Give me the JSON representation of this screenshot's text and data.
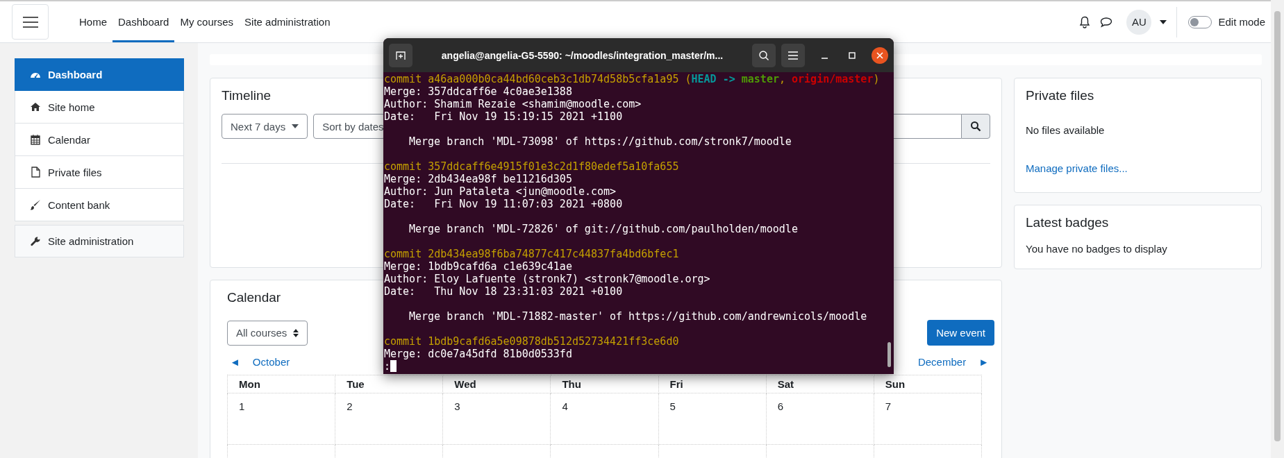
{
  "navbar": {
    "links": [
      {
        "label": "Home",
        "selected": false
      },
      {
        "label": "Dashboard",
        "selected": true
      },
      {
        "label": "My courses",
        "selected": false
      },
      {
        "label": "Site administration",
        "selected": false
      }
    ],
    "avatar": "AU",
    "edit_mode": {
      "label": "Edit mode",
      "on": false
    }
  },
  "sidebar": {
    "items": [
      {
        "label": "Dashboard",
        "selected": true
      },
      {
        "label": "Site home",
        "selected": false
      },
      {
        "label": "Calendar",
        "selected": false
      },
      {
        "label": "Private files",
        "selected": false
      },
      {
        "label": "Content bank",
        "selected": false
      }
    ],
    "admin": {
      "label": "Site administration",
      "selected": false
    }
  },
  "timeline": {
    "title": "Timeline",
    "filter": "Next 7 days",
    "sort": "Sort by dates"
  },
  "calendar": {
    "title": "Calendar",
    "course_filter": "All courses",
    "new_event": "New event",
    "prev": {
      "arrow": "◄",
      "label": "October"
    },
    "next": {
      "arrow": "►",
      "label": "December"
    },
    "days": [
      "Mon",
      "Tue",
      "Wed",
      "Thu",
      "Fri",
      "Sat",
      "Sun"
    ],
    "weeks": [
      [
        "1",
        "2",
        "3",
        "4",
        "5",
        "6",
        "7"
      ]
    ]
  },
  "private_files": {
    "title": "Private files",
    "message": "No files available",
    "link": "Manage private files..."
  },
  "latest_badges": {
    "title": "Latest badges",
    "message": "You have no badges to display"
  },
  "terminal": {
    "title": "angelia@angelia-G5-5590: ~/moodles/integration_master/m...",
    "lines": [
      {
        "kind": "commit",
        "segments": [
          {
            "kind": "plain",
            "text": "commit a46aa000b0ca44bd60ceb3c1db74d58b5cfa1a95 ("
          },
          {
            "kind": "head",
            "text": "HEAD -> "
          },
          {
            "kind": "branch",
            "text": "master"
          },
          {
            "kind": "plain",
            "text": ", "
          },
          {
            "kind": "remote",
            "text": "origin/master"
          },
          {
            "kind": "plain",
            "text": ")"
          }
        ]
      },
      {
        "kind": "text",
        "segments": [
          {
            "kind": "plain",
            "text": "Merge: 357ddcaff6e 4c0ae3e1388"
          }
        ]
      },
      {
        "kind": "text",
        "segments": [
          {
            "kind": "plain",
            "text": "Author: Shamim Rezaie <shamim@moodle.com>"
          }
        ]
      },
      {
        "kind": "text",
        "segments": [
          {
            "kind": "plain",
            "text": "Date:   Fri Nov 19 15:19:15 2021 +1100"
          }
        ]
      },
      {
        "kind": "message",
        "segments": [
          {
            "kind": "plain",
            "text": "Merge branch 'MDL-73098' of https://github.com/stronk7/moodle"
          }
        ]
      },
      {
        "kind": "commit",
        "segments": [
          {
            "kind": "plain",
            "text": "commit 357ddcaff6e4915f01e3c2d1f80edef5a10fa655"
          }
        ]
      },
      {
        "kind": "text",
        "segments": [
          {
            "kind": "plain",
            "text": "Merge: 2db434ea98f be11216d305"
          }
        ]
      },
      {
        "kind": "text",
        "segments": [
          {
            "kind": "plain",
            "text": "Author: Jun Pataleta <jun@moodle.com>"
          }
        ]
      },
      {
        "kind": "text",
        "segments": [
          {
            "kind": "plain",
            "text": "Date:   Fri Nov 19 11:07:03 2021 +0800"
          }
        ]
      },
      {
        "kind": "message",
        "segments": [
          {
            "kind": "plain",
            "text": "Merge branch 'MDL-72826' of git://github.com/paulholden/moodle"
          }
        ]
      },
      {
        "kind": "commit",
        "segments": [
          {
            "kind": "plain",
            "text": "commit 2db434ea98f6ba74877c417c44837fa4bd6bfec1"
          }
        ]
      },
      {
        "kind": "text",
        "segments": [
          {
            "kind": "plain",
            "text": "Merge: 1bdb9cafd6a c1e639c41ae"
          }
        ]
      },
      {
        "kind": "text",
        "segments": [
          {
            "kind": "plain",
            "text": "Author: Eloy Lafuente (stronk7) <stronk7@moodle.org>"
          }
        ]
      },
      {
        "kind": "text",
        "segments": [
          {
            "kind": "plain",
            "text": "Date:   Thu Nov 18 23:31:03 2021 +0100"
          }
        ]
      },
      {
        "kind": "message",
        "segments": [
          {
            "kind": "plain",
            "text": "Merge branch 'MDL-71882-master' of https://github.com/andrewnicols/moodle"
          }
        ]
      },
      {
        "kind": "commit",
        "segments": [
          {
            "kind": "plain",
            "text": "commit 1bdb9cafd6a5e09878db512d52734421ff3ce6d0"
          }
        ]
      },
      {
        "kind": "text",
        "segments": [
          {
            "kind": "plain",
            "text": "Merge: dc0e7a45dfd 81b0d0533fd"
          }
        ]
      },
      {
        "kind": "prompt",
        "segments": [
          {
            "kind": "plain",
            "text": ":"
          }
        ]
      }
    ]
  }
}
